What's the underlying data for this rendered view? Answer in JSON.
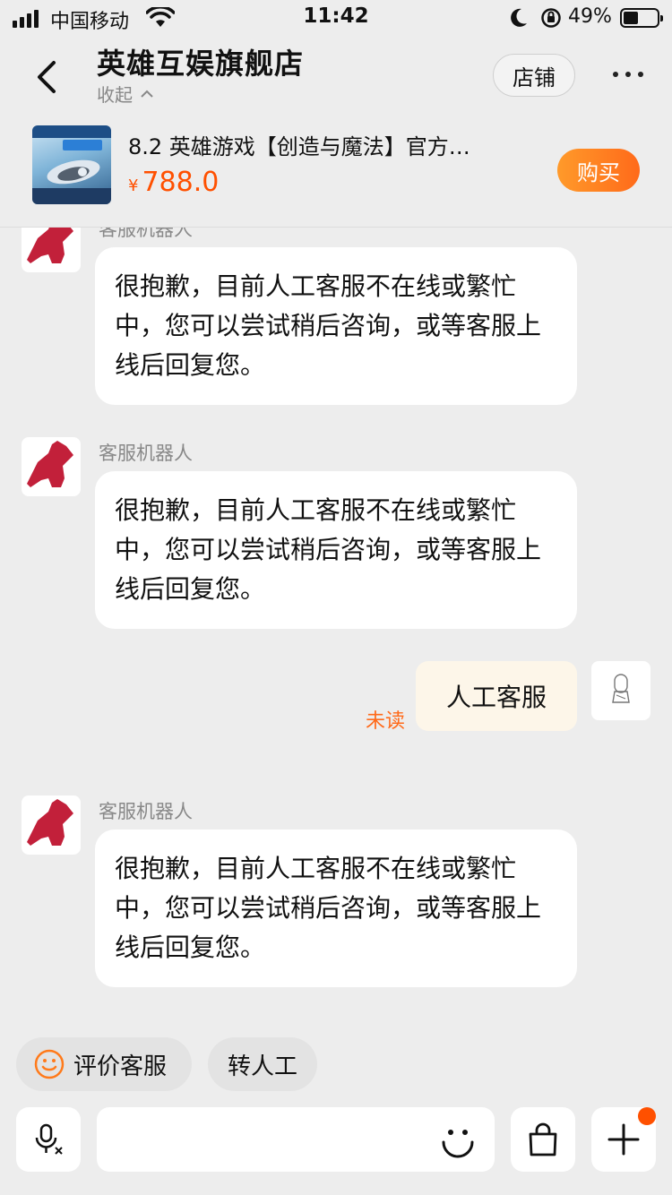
{
  "status_bar": {
    "carrier": "中国移动",
    "time": "11:42",
    "battery_pct": "49%",
    "battery_level": 0.49
  },
  "header": {
    "shop_name": "英雄互娱旗舰店",
    "collapse_label": "收起",
    "store_button": "店铺"
  },
  "product": {
    "title": "8.2 英雄游戏【创造与魔法】官方…",
    "currency": "¥",
    "price": "788.0",
    "buy_button": "购买"
  },
  "messages": [
    {
      "sender": "客服机器人",
      "text": "很抱歉，目前人工客服不在线或繁忙中，您可以尝试稍后咨询，或等客服上线后回复您。"
    },
    {
      "sender": "客服机器人",
      "text": "很抱歉，目前人工客服不在线或繁忙中，您可以尝试稍后咨询，或等客服上线后回复您。"
    },
    {
      "sender": "me",
      "text": "人工客服",
      "status": "未读"
    },
    {
      "sender": "客服机器人",
      "text": "很抱歉，目前人工客服不在线或繁忙中，您可以尝试稍后咨询，或等客服上线后回复您。"
    }
  ],
  "quick_actions": {
    "rate": "评价客服",
    "transfer": "转人工"
  },
  "input": {
    "placeholder": ""
  },
  "colors": {
    "accent": "#ff5000",
    "bot_avatar": "#c2203a",
    "my_bubble": "#fdf6e9"
  }
}
